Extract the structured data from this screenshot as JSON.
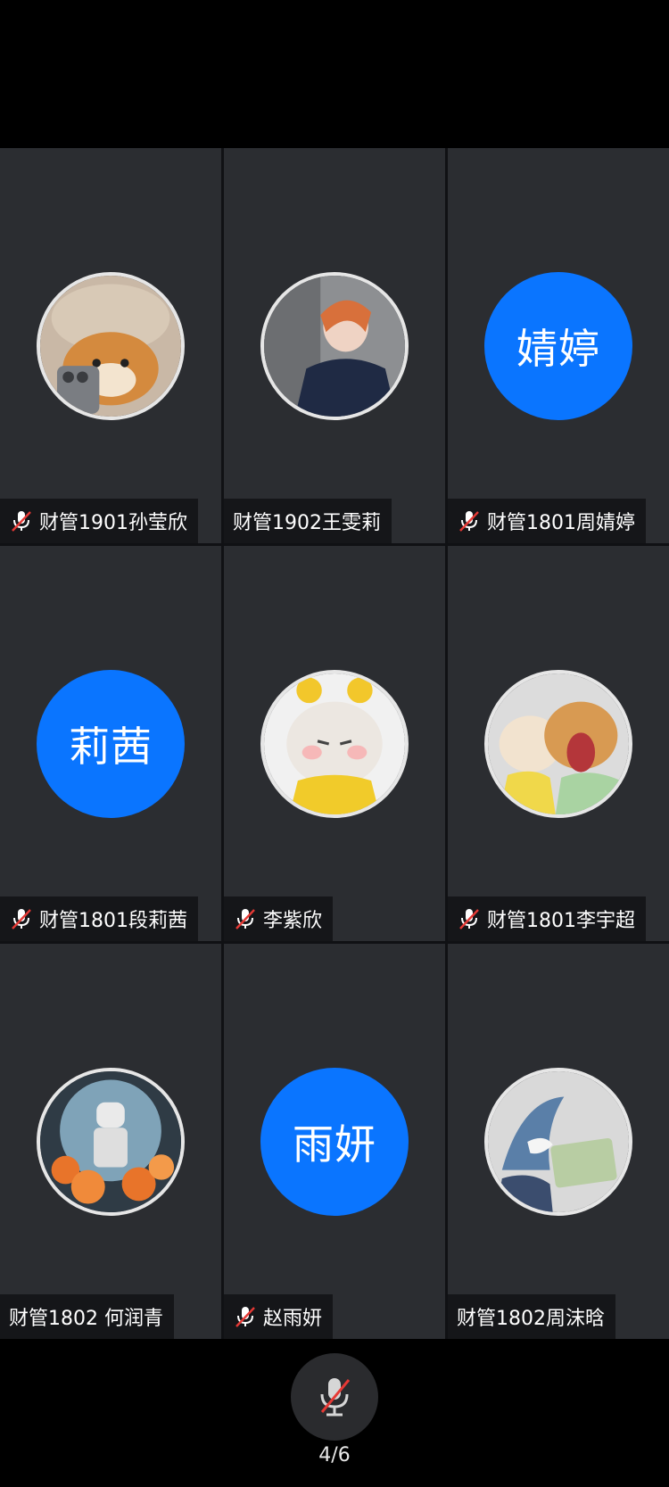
{
  "participants": [
    {
      "name": "财管1901孙莹欣",
      "muted": true,
      "avatar_type": "photo",
      "avatar_desc": "shiba-dog-hat"
    },
    {
      "name": "财管1902王雯莉",
      "muted": false,
      "avatar_type": "photo",
      "avatar_desc": "cosplay-person"
    },
    {
      "name": "财管1801周婧婷",
      "muted": true,
      "avatar_type": "initials",
      "initials": "婧婷"
    },
    {
      "name": "财管1801段莉茜",
      "muted": true,
      "avatar_type": "initials",
      "initials": "莉茜"
    },
    {
      "name": "李紫欣",
      "muted": true,
      "avatar_type": "photo",
      "avatar_desc": "white-cat-bee-hat"
    },
    {
      "name": "财管1801李宇超",
      "muted": true,
      "avatar_type": "photo",
      "avatar_desc": "cat-and-shiba"
    },
    {
      "name": "财管1802 何润青",
      "muted": false,
      "avatar_type": "photo",
      "avatar_desc": "astronaut-flowers"
    },
    {
      "name": "赵雨妍",
      "muted": true,
      "avatar_type": "initials",
      "initials": "雨妍"
    },
    {
      "name": "财管1802周沫晗",
      "muted": false,
      "avatar_type": "photo",
      "avatar_desc": "shark-plush"
    }
  ],
  "footer": {
    "mic_icon": "mic-muted-icon",
    "page_indicator": "4/6"
  },
  "colors": {
    "tile_background": "#2b2d31",
    "initials_avatar": "#0a75ff",
    "mute_slash": "#e53935"
  }
}
